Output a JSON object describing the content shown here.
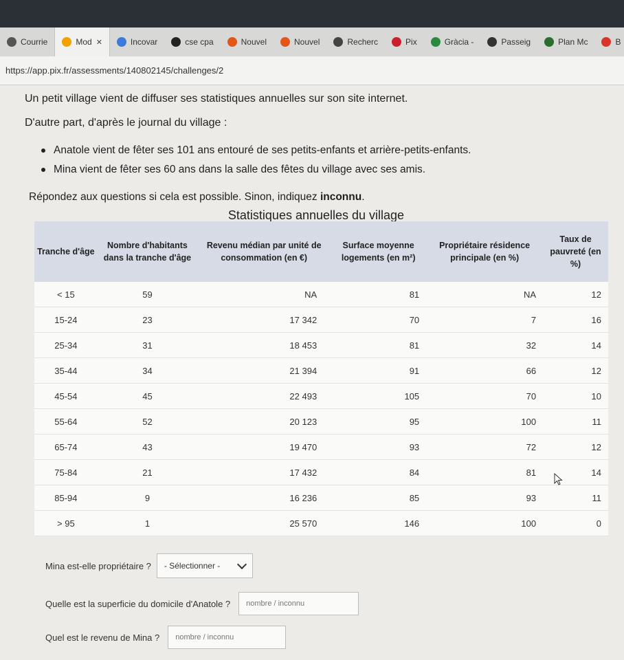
{
  "browser": {
    "tabs": [
      {
        "label": "Courrie",
        "icon": "mail-icon",
        "color": "#555555"
      },
      {
        "label": "Mod",
        "icon": "pix-arrow-icon",
        "color": "#f2a200",
        "active": true
      },
      {
        "label": "Incovar",
        "icon": "sparkle-icon",
        "color": "#3c7bd9"
      },
      {
        "label": "cse cpa",
        "icon": "app-icon",
        "color": "#222222"
      },
      {
        "label": "Nouvel",
        "icon": "firefox-icon",
        "color": "#e2561b"
      },
      {
        "label": "Nouvel",
        "icon": "firefox-icon",
        "color": "#e2561b"
      },
      {
        "label": "Recherc",
        "icon": "search-icon",
        "color": "#444444"
      },
      {
        "label": "Pix",
        "icon": "pinterest-icon",
        "color": "#cc1f2e"
      },
      {
        "label": "Gràcia -",
        "icon": "map-pin-icon",
        "color": "#2b8a3e"
      },
      {
        "label": "Passeig",
        "icon": "wikipedia-icon",
        "color": "#333333"
      },
      {
        "label": "Plan Mc",
        "icon": "transit-icon",
        "color": "#2a6e2f"
      },
      {
        "label": "B",
        "icon": "location-icon",
        "color": "#d9362b"
      }
    ],
    "active_tab_close": "✕",
    "url": "https://app.pix.fr/assessments/140802145/challenges/2"
  },
  "intro": {
    "line1": "Un petit village vient de diffuser ses statistiques annuelles sur son site internet.",
    "line2": "D'autre part, d'après le journal du village :",
    "bullets": [
      "Anatole vient de fêter ses 101 ans entouré de ses petits-enfants et arrière-petits-enfants.",
      "Mina vient de fêter ses 60 ans dans la salle des fêtes du village avec ses amis."
    ],
    "question_prefix": "Répondez aux questions si cela est possible. Sinon, indiquez ",
    "question_bold": "inconnu",
    "question_suffix": "."
  },
  "table": {
    "title": "Statistiques annuelles du village",
    "headers": [
      "Tranche d'âge",
      "Nombre d'habitants dans la tranche d'âge",
      "Revenu médian par unité de consommation (en €)",
      "Surface moyenne logements (en m²)",
      "Propriétaire résidence principale (en %)",
      "Taux de pauvreté (en %)"
    ],
    "rows": [
      [
        "< 15",
        "59",
        "NA",
        "81",
        "NA",
        "12"
      ],
      [
        "15-24",
        "23",
        "17 342",
        "70",
        "7",
        "16"
      ],
      [
        "25-34",
        "31",
        "18 453",
        "81",
        "32",
        "14"
      ],
      [
        "35-44",
        "34",
        "21 394",
        "91",
        "66",
        "12"
      ],
      [
        "45-54",
        "45",
        "22 493",
        "105",
        "70",
        "10"
      ],
      [
        "55-64",
        "52",
        "20 123",
        "95",
        "100",
        "11"
      ],
      [
        "65-74",
        "43",
        "19 470",
        "93",
        "72",
        "12"
      ],
      [
        "75-84",
        "21",
        "17 432",
        "84",
        "81",
        "14"
      ],
      [
        "85-94",
        "9",
        "16 236",
        "85",
        "93",
        "11"
      ],
      [
        "> 95",
        "1",
        "25 570",
        "146",
        "100",
        "0"
      ]
    ]
  },
  "form": {
    "q1_label": "Mina est-elle propriétaire ?",
    "q1_select": "- Sélectionner -",
    "q2_label": "Quelle est la superficie du domicile d'Anatole ?",
    "q2_placeholder": "nombre / inconnu",
    "q3_label": "Quel est le revenu de Mina ?",
    "q3_placeholder": "nombre / inconnu"
  }
}
